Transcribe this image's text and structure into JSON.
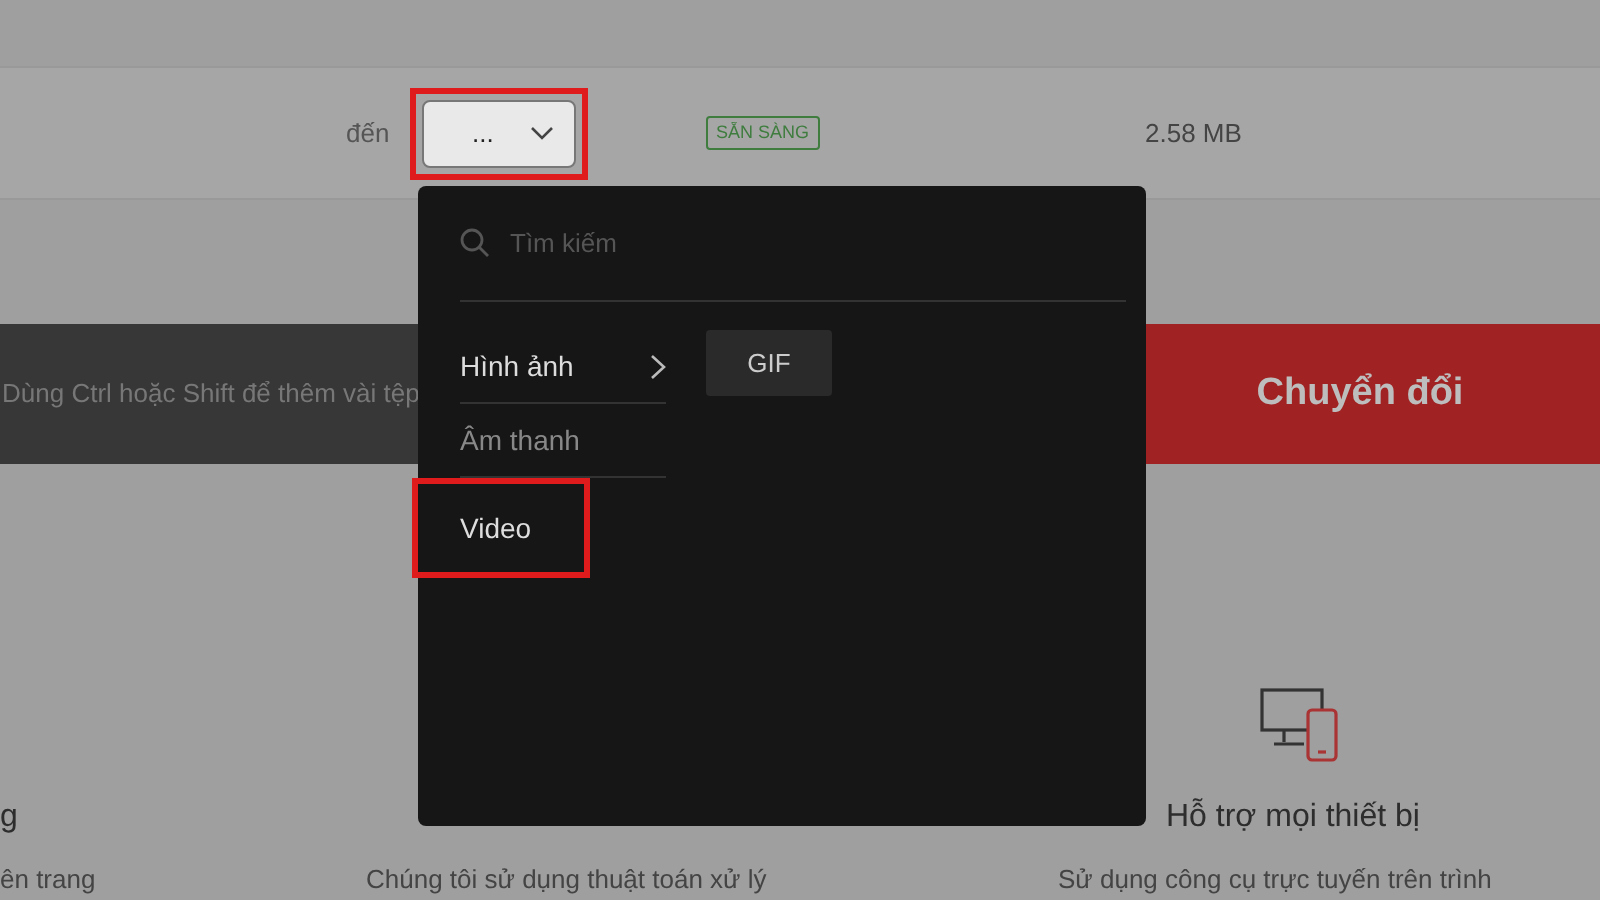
{
  "file_row": {
    "to_label": "đến",
    "format_dropdown": {
      "value": "...",
      "highlighted": true
    },
    "status_badge": "SẴN SÀNG",
    "size": "2.58 MB"
  },
  "drop_bar": {
    "hint": "Dùng Ctrl hoặc Shift để thêm vài tệp",
    "convert_button": "Chuyển đổi"
  },
  "features": [
    {
      "heading": "g",
      "description": "ên trang"
    },
    {
      "description": "Chúng tôi sử dụng thuật toán xử lý"
    },
    {
      "heading": "Hỗ trợ mọi thiết bị",
      "description": "Sử dụng công cụ trực tuyến trên trình",
      "icon": true
    }
  ],
  "format_menu": {
    "search": {
      "placeholder": "Tìm kiếm"
    },
    "categories": [
      {
        "label": "Hình ảnh",
        "selected": true,
        "dimmed": false,
        "highlighted": false
      },
      {
        "label": "Âm thanh",
        "selected": false,
        "dimmed": true,
        "highlighted": false
      },
      {
        "label": "Video",
        "selected": false,
        "dimmed": false,
        "highlighted": true
      }
    ],
    "formats": [
      "GIF"
    ]
  }
}
